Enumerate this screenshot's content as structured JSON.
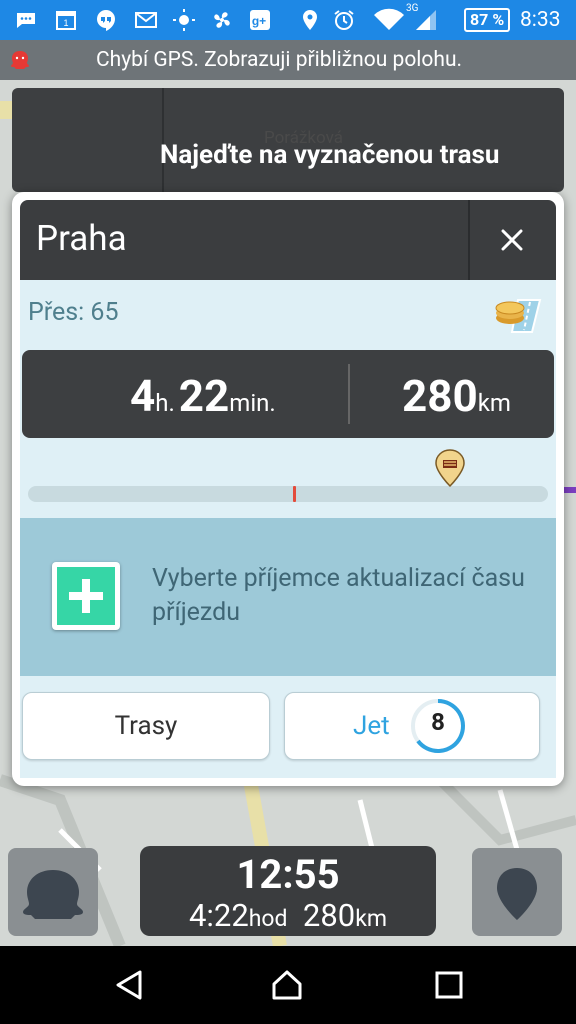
{
  "status_bar": {
    "battery": "87 %",
    "network": "3G",
    "time": "8:33",
    "icons": [
      "chat-icon",
      "calendar-icon",
      "hangouts-icon",
      "gmail-icon",
      "weather-icon",
      "fan-icon",
      "google-plus-icon",
      "location-icon",
      "alarm-icon",
      "wifi-icon",
      "signal-icon",
      "battery-icon"
    ]
  },
  "map": {
    "gps_message": "Chybí GPS. Zobrazuji přibližnou polohu.",
    "street_label": "Porážková",
    "instruction": "Najeďte na vyznačenou trasu"
  },
  "dialog": {
    "title": "Praha",
    "via": "Přes: 65",
    "duration_hours": "4",
    "duration_hours_unit": "h.",
    "duration_minutes": "22",
    "duration_minutes_unit": "min.",
    "distance": "280",
    "distance_unit": "km",
    "recipient_prompt": "Vyberte příjemce aktualizací času příjezdu",
    "routes_button": "Trasy",
    "go_button": "Jet",
    "countdown": "8",
    "progress_marker_fraction": 0.51
  },
  "bottom": {
    "eta_time": "12:55",
    "eta_duration": "4:22",
    "eta_duration_unit": "hod",
    "eta_distance": "280",
    "eta_distance_unit": "km"
  },
  "colors": {
    "status_bar": "#1e88e5",
    "accent": "#2fa3e0",
    "add_green": "#36d6a6",
    "panel_dark": "#3d3f41"
  }
}
